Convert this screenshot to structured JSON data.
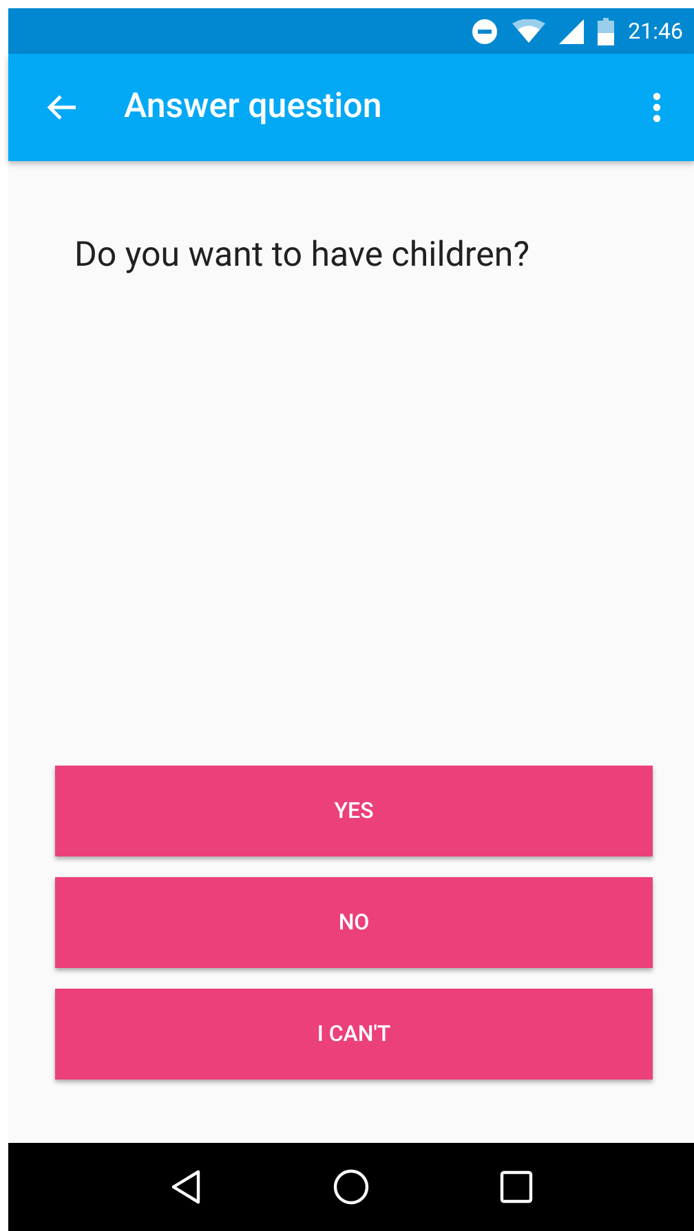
{
  "status_bar": {
    "time": "21:46"
  },
  "app_bar": {
    "title": "Answer question"
  },
  "question": "Do you want to have children?",
  "answers": [
    {
      "label": "YES"
    },
    {
      "label": "NO"
    },
    {
      "label": "I CAN'T"
    }
  ]
}
